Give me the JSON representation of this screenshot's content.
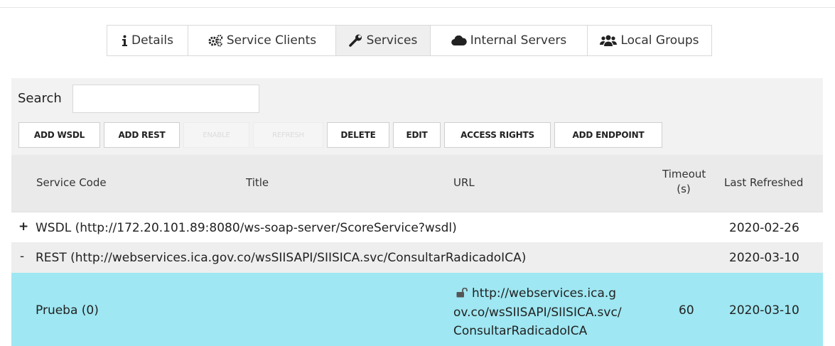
{
  "tabs": [
    {
      "label": "Details",
      "icon": "info-icon",
      "active": false
    },
    {
      "label": "Service Clients",
      "icon": "cogs-icon",
      "active": false
    },
    {
      "label": "Services",
      "icon": "wrench-icon",
      "active": true
    },
    {
      "label": "Internal Servers",
      "icon": "cloud-icon",
      "active": false
    },
    {
      "label": "Local Groups",
      "icon": "users-icon",
      "active": false
    }
  ],
  "search": {
    "label": "Search",
    "value": "",
    "placeholder": ""
  },
  "buttons": {
    "add_wsdl": "ADD WSDL",
    "add_rest": "ADD REST",
    "enable": "ENABLE",
    "refresh": "REFRESH",
    "delete": "DELETE",
    "edit": "EDIT",
    "access_rights": "ACCESS RIGHTS",
    "add_endpoint": "ADD ENDPOINT"
  },
  "table": {
    "headers": {
      "service_code": "Service Code",
      "title": "Title",
      "url": "URL",
      "timeout_1": "Timeout",
      "timeout_2": "(s)",
      "last_refreshed": "Last Refreshed"
    },
    "groups": [
      {
        "toggle": "+",
        "label": "WSDL (http://172.20.101.89:8080/ws-soap-server/ScoreService?wsdl)",
        "last_refreshed": "2020-02-26"
      },
      {
        "toggle": "-",
        "label": "REST (http://webservices.ica.gov.co/wsSIISAPI/SIISICA.svc/ConsultarRadicadoICA)",
        "last_refreshed": "2020-03-10"
      }
    ],
    "service": {
      "code": "Prueba (0)",
      "title": "",
      "url_lines": [
        "http://webservices.ica.g",
        "ov.co/wsSIISAPI/SIISICA.svc/",
        "ConsultarRadicadoICA"
      ],
      "url_icon": "unlock-icon",
      "timeout": "60",
      "last_refreshed": "2020-03-10"
    }
  },
  "colors": {
    "selected_row": "#9fe7f2",
    "panel": "#f2f2f2",
    "header": "#eaeaea"
  }
}
